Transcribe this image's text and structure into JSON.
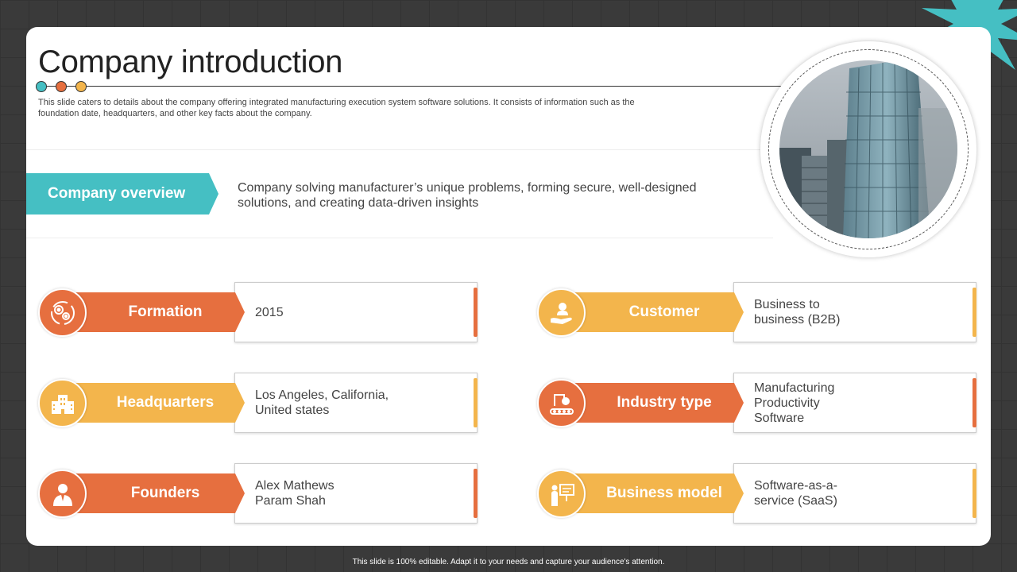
{
  "title": "Company introduction",
  "description": "This slide caters to details about the company offering integrated manufacturing execution system software solutions. It consists of information such as the foundation date, headquarters, and other key facts about the company.",
  "overview": {
    "label": "Company overview",
    "text": "Company solving manufacturer’s unique problems, forming secure, well-designed solutions, and creating data-driven insights"
  },
  "facts": [
    {
      "label": "Formation",
      "value_lines": [
        "2015"
      ],
      "color": "#e66f3f",
      "icon": "gears-icon"
    },
    {
      "label": "Headquarters",
      "value_lines": [
        "Los Angeles, California,",
        "United states"
      ],
      "color": "#f3b54c",
      "icon": "building-icon"
    },
    {
      "label": "Founders",
      "value_lines": [
        "Alex Mathews",
        "Param Shah"
      ],
      "color": "#e66f3f",
      "icon": "person-icon"
    },
    {
      "label": "Customer",
      "value_lines": [
        "Business to",
        "business (B2B)"
      ],
      "color": "#f3b54c",
      "icon": "hand-person-icon"
    },
    {
      "label": "Industry type",
      "value_lines": [
        "Manufacturing",
        "Productivity",
        "Software"
      ],
      "color": "#e66f3f",
      "icon": "robot-arm-icon"
    },
    {
      "label": "Business model",
      "value_lines": [
        "Software-as-a-",
        "service (SaaS)"
      ],
      "color": "#f3b54c",
      "icon": "presentation-icon"
    }
  ],
  "colors": {
    "teal": "#45bfc3",
    "orange": "#e66f3f",
    "yellow": "#f3b54c"
  },
  "footer": "This slide is 100% editable. Adapt it to your needs and capture your audience's attention."
}
